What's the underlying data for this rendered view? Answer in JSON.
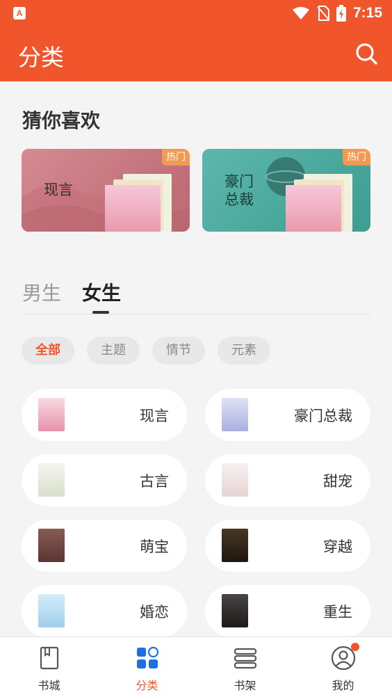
{
  "status_bar": {
    "time": "7:15",
    "app_icon_letter": "A"
  },
  "header": {
    "title": "分类",
    "search_icon": "search-icon"
  },
  "recommend": {
    "title": "猜你喜欢",
    "cards": [
      {
        "label": "现言",
        "badge": "热门",
        "color": "#c97c85"
      },
      {
        "label": "豪门\n总裁",
        "badge": "热门",
        "color": "#4aa79b"
      }
    ]
  },
  "gender_tabs": [
    {
      "label": "男生",
      "active": false
    },
    {
      "label": "女生",
      "active": true
    }
  ],
  "filters": [
    {
      "label": "全部",
      "active": true
    },
    {
      "label": "主题",
      "active": false
    },
    {
      "label": "情节",
      "active": false
    },
    {
      "label": "元素",
      "active": false
    }
  ],
  "categories": [
    {
      "name": "现言",
      "cover_color": "#f3c7d2"
    },
    {
      "name": "豪门总裁",
      "cover_color": "#c9cdea"
    },
    {
      "name": "古言",
      "cover_color": "#eef0e6"
    },
    {
      "name": "甜宠",
      "cover_color": "#f4ecec"
    },
    {
      "name": "萌宝",
      "cover_color": "#7a4d49"
    },
    {
      "name": "穿越",
      "cover_color": "#3b2a1e"
    },
    {
      "name": "婚恋",
      "cover_color": "#bfe0f4"
    },
    {
      "name": "重生",
      "cover_color": "#2d2a2a"
    }
  ],
  "bottom_nav": [
    {
      "label": "书城",
      "icon": "book-icon",
      "active": false
    },
    {
      "label": "分类",
      "icon": "category-grid-icon",
      "active": true
    },
    {
      "label": "书架",
      "icon": "bookshelf-icon",
      "active": false
    },
    {
      "label": "我的",
      "icon": "profile-icon",
      "active": false,
      "has_dot": true
    }
  ],
  "colors": {
    "accent": "#f0552b",
    "background": "#f4f4f4",
    "hot_badge": "#f29a52"
  }
}
